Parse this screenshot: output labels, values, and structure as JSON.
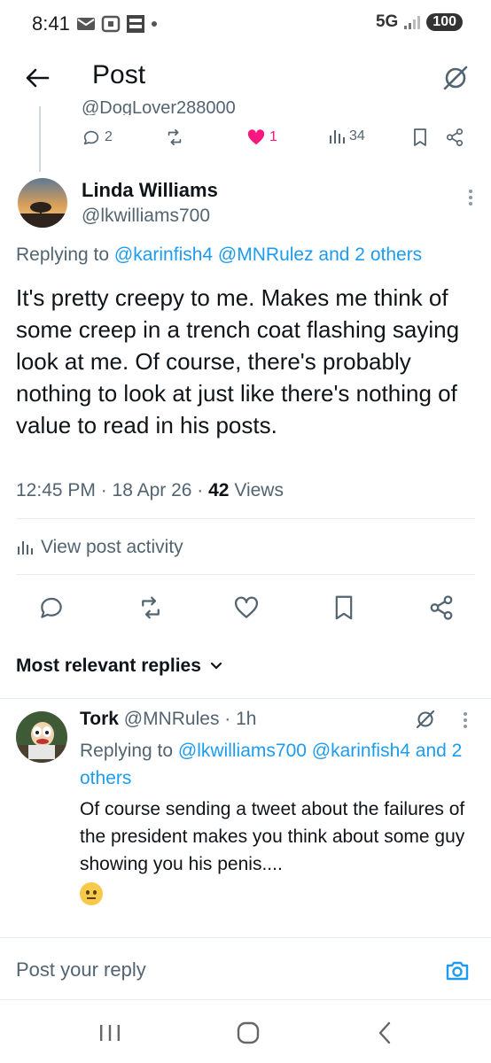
{
  "status_bar": {
    "time": "8:41",
    "network": "5G",
    "battery": "100"
  },
  "header": {
    "title": "Post"
  },
  "parent_post": {
    "handle": "@DogLover288000",
    "replies": "2",
    "likes": "1",
    "views": "34"
  },
  "main_post": {
    "name": "Linda Williams",
    "handle": "@lkwilliams700",
    "replying_prefix": "Replying to ",
    "replying_targets": "@karinfish4 @MNRulez and 2 others",
    "text": "It's pretty creepy to me. Makes me think of some creep in a trench coat flashing saying look at me. Of course, there's probably nothing to look at just like there's nothing of value to read in his posts.",
    "time": "12:45 PM · 18 Apr 26 · ",
    "views_count": "42",
    "views_label": " Views",
    "activity_label": "View post activity"
  },
  "replies_section": {
    "sort_label": "Most relevant replies"
  },
  "reply": {
    "name": "Tork",
    "handle_time": " @MNRules · 1h",
    "replying_prefix": "Replying to ",
    "replying_targets": "@lkwilliams700 @karinfish4 and 2 others",
    "text": "Of course sending a tweet about the failures of the president makes you think about some guy showing you his penis...."
  },
  "composer": {
    "placeholder": "Post your reply"
  },
  "colors": {
    "link": "#1d9bf0",
    "like": "#f91880",
    "secondary_text": "#536471"
  }
}
